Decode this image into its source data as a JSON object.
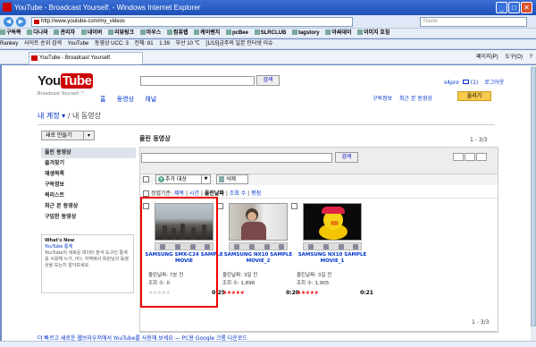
{
  "window": {
    "title": "YouTube - Broadcast Yourself. - Windows Internet Explorer",
    "url": "http://www.youtube.com/my_videos",
    "search_placeholder": "Naver",
    "min": "_",
    "max": "□",
    "close": "✕",
    "back": "◀",
    "forward": "▶"
  },
  "toolbar1": [
    "구독쪽",
    "다나와",
    "관리자",
    "네이버",
    "리뷰링크",
    "마우스",
    "컴퓨랩",
    "케이벤치",
    "pcBee",
    "SLRCLUB",
    "tagstory",
    "아싸데이",
    "이미지 호칭"
  ],
  "toolbar2": [
    "Rankey",
    "사이트 순위 검색",
    "YouTube",
    "동영상 UCC: 3",
    "전체: 81",
    "1.39",
    "부산 10 ℃",
    "[1/15]금주의 일본 인터넷 이슈"
  ],
  "tab": {
    "label": "YouTube - Broadcast Yourself."
  },
  "tab_tools": [
    "페이지(P)",
    "도구(O)",
    "?"
  ],
  "yt": {
    "logo_you": "You",
    "logo_tube": "Tube",
    "logo_sub": "Broadcast Yourself ™",
    "search_button": "검색",
    "nav": [
      "홈",
      "동영상",
      "채널"
    ],
    "username": "s4pro",
    "msg_count": "(1)",
    "logout": "로그아웃",
    "subscriptions": "구독정보",
    "recently_viewed": "최근 본 동영상",
    "upload": "올리기"
  },
  "breadcrumb": {
    "account": "내 계정",
    "sep": "/",
    "current": "내 동영상"
  },
  "sidebar": {
    "new_button": "새로 만들기",
    "items": [
      "올린 동영상",
      "즐겨찾기",
      "재생목록",
      "구독정보",
      "퀵리스트",
      "최근 본 동영상",
      "구입한 동영상"
    ],
    "whatsnew_title": "What's New",
    "whatsnew_link": "YouTube 통계",
    "whatsnew_body": "YouTube의 새로운 데이터 분석 도구인 통계를 사용해 누가, 어느 지역에서 회원님의 동영상을 보는지 알아보세요."
  },
  "main": {
    "title": "올린 동영상",
    "range": "1 - 3/3",
    "filter_button": "검색",
    "add_to": "추가 대상",
    "delete": "삭제",
    "sort_label": "정렬기준:",
    "sort_options": [
      "제목",
      "시간",
      "올린날짜",
      "조회 수",
      "평점"
    ],
    "sort_active_index": 2
  },
  "videos": [
    {
      "title": "SAMSUNG SMX-C24 SAMPLE MOVIE",
      "date": "올린날짜: 7분 전",
      "views": "조회 수: 0",
      "stars": "★★★★★",
      "duration": "0:25",
      "rated": false
    },
    {
      "title": "SAMSUNG NX10 SAMPLE MOVIE_2",
      "date": "올린날짜: 3일 전",
      "views": "조회 수: 1,896",
      "stars": "★★★★★",
      "duration": "0:20",
      "rated": true
    },
    {
      "title": "SAMSUNG NX10 SAMPLE MOVIE_1",
      "date": "올린날짜: 3일 전",
      "views": "조회 수: 1,905",
      "stars": "★★★★★",
      "duration": "0:21",
      "rated": true
    }
  ],
  "footer_note": "더 빠르고 새로운 웹브라우저에서 YouTube를 사용해 보세요 — PC용 Google 크롬 다운로드",
  "colors": {
    "link": "#0033cc",
    "brand_red": "#cc0000",
    "star": "#e11111",
    "star_empty": "#cccccc",
    "selection": "#ee0000"
  }
}
